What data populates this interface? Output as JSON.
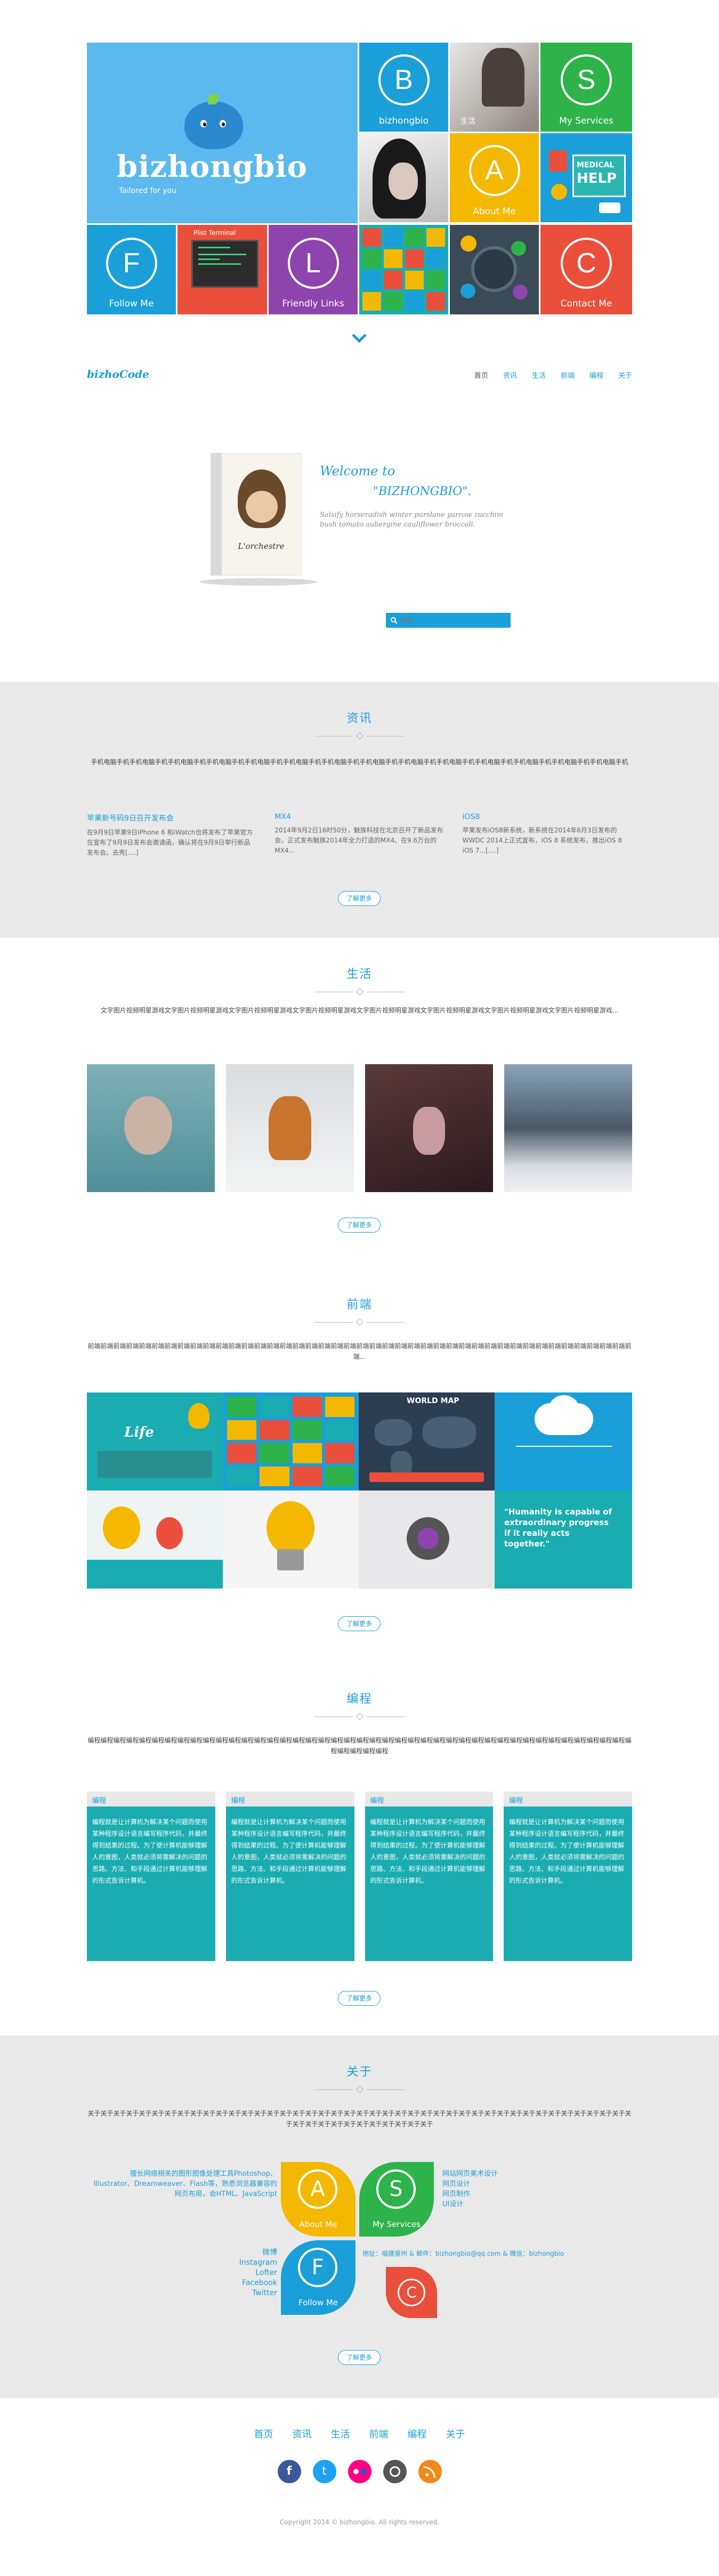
{
  "metro": {
    "brand": "bizhongbio",
    "tagline": "Tailored for you",
    "tiles": {
      "bizhongbio": {
        "letter": "B",
        "label": "bizhongbio"
      },
      "life": {
        "label": "生活"
      },
      "services": {
        "letter": "S",
        "label": "My Services"
      },
      "about": {
        "letter": "A",
        "label": "About Me"
      },
      "follow": {
        "letter": "F",
        "label": "Follow Me"
      },
      "terminal": {
        "title": "Plist Terminal"
      },
      "links": {
        "letter": "L",
        "label": "Friendly Links"
      },
      "contact": {
        "letter": "C",
        "label": "Contact Me"
      },
      "medical": {
        "line1": "MEDICAL",
        "line2": "HELP"
      }
    }
  },
  "nav": {
    "logo": "bizhoCode",
    "items": [
      "首页",
      "资讯",
      "生活",
      "前端",
      "编程",
      "关于"
    ]
  },
  "welcome": {
    "heading": "Welcome to",
    "name": "\"BIZHONGBIO\".",
    "body": "Salsify horseradish winter purslane yarrow zucchini bush tomato aubergine cauliflower broccoli.",
    "book_title": "L'orchestre"
  },
  "search": {
    "placeholder": "搜索"
  },
  "news": {
    "title": "资讯",
    "intro": "手机电脑手机手机电脑手机手机电脑手机手机电脑手机手机电脑手机手机电脑手机手机电脑手机手机电脑手机手机电脑手机手机电脑手机手机电脑手机手机电脑手机手机电脑手机手机电脑手机",
    "items": [
      {
        "title": "苹果新号码9日召开发布会",
        "body": "在9月9日苹果9日iPhone 6 和iWatch也将发布了苹果官方在宣布了9月9日发布会邀请函，确认将在9月9日举行新品发布会。去秀[....]"
      },
      {
        "title": "MX4",
        "body": "2014年9月2日16时50分，魅族科技在北京召开了新品发布会，正式发布魅族2014年全力打造的MX4。在9.6万台的MX4..."
      },
      {
        "title": "iOS8",
        "body": "苹果发布iOS8新系统，新系统在2014年6月3日发布的WWDC 2014上正式宣布，iOS 8 系统发布，推出iOS 8 iOS 7...[....]"
      }
    ],
    "more": "了解更多"
  },
  "life": {
    "title": "生活",
    "intro": "文字图片视频明星游戏文字图片视频明星游戏文字图片视频明星游戏文字图片视频明星游戏文字图片视频明星游戏文字图片视频明星游戏文字图片视频明星游戏文字图片视频明星游戏...",
    "more": "了解更多"
  },
  "frontend": {
    "title": "前端",
    "intro": "前端前端前端前端前端前端前端前端前端前端前端前端前端前端前端前端前端前端前端前端前端前端前端前端前端前端前端前端前端前端前端前端前端前端前端前端前端前端前端前端前端前端前端...",
    "life_label": "Life",
    "world_map": "WORLD MAP",
    "quote": "\"Humanity is capable of extraordinary progress if it really acts together.\"",
    "more": "了解更多"
  },
  "programming": {
    "title": "编程",
    "intro": "编程编程编程编程编程编程编程编程编程编程编程编程编程编程编程编程编程编程编程编程编程编程编程编程编程编程编程编程编程编程编程编程编程编程编程编程编程编程编程编程编程编程编程编程编程编程编程",
    "cards": [
      {
        "title": "编程",
        "body": "编程就是让计算机为解决某个问题而使用某种程序设计语言编写程序代码，并最终得到结果的过程。为了使计算机能够理解人的意图，人类就必须将需解决的问题的思路、方法、和手段通过计算机能够理解的形式告诉计算机。"
      },
      {
        "title": "编程",
        "body": "编程就是让计算机为解决某个问题而使用某种程序设计语言编写程序代码，并最终得到结果的过程。为了使计算机能够理解人的意图，人类就必须将需解决的问题的思路、方法、和手段通过计算机能够理解的形式告诉计算机。"
      },
      {
        "title": "编程",
        "body": "编程就是让计算机为解决某个问题而使用某种程序设计语言编写程序代码，并最终得到结果的过程。为了使计算机能够理解人的意图，人类就必须将需解决的问题的思路、方法、和手段通过计算机能够理解的形式告诉计算机。"
      },
      {
        "title": "编程",
        "body": "编程就是让计算机为解决某个问题而使用某种程序设计语言编写程序代码，并最终得到结果的过程。为了使计算机能够理解人的意图，人类就必须将需解决的问题的思路、方法、和手段通过计算机能够理解的形式告诉计算机。"
      }
    ],
    "more": "了解更多"
  },
  "about": {
    "title": "关于",
    "intro": "关于关于关于关于关于关于关于关于关于关于关于关于关于关于关于关于关于关于关于关于关于关于关于关于关于关于关于关于关于关于关于关于关于关于关于关于关于关于关于关于关于关于关于关于关于关于关于关于关于关于关于关于关于关于",
    "about_text": "擅长网络相关的图形图像处理工具Photoshop、Illustrator、Dreamweaver、Flash等，熟悉浏览器兼容的网页布局，会HTML、JavaScript",
    "services": [
      "网站网页美术设计",
      "网页设计",
      "网页制作",
      "UI设计"
    ],
    "follow": [
      "微博",
      "Instagram",
      "Lofter",
      "Facebook",
      "Twitter"
    ],
    "contact": "地址：福建泉州 & 邮件：bizhongbio@qq.com & 微信：bizhongbio",
    "petals": {
      "about": {
        "letter": "A",
        "label": "About Me"
      },
      "services": {
        "letter": "S",
        "label": "My Services"
      },
      "follow": {
        "letter": "F",
        "label": "Follow Me"
      },
      "contact": {
        "letter": "C"
      }
    },
    "more": "了解更多"
  },
  "footer": {
    "nav": [
      "首页",
      "资讯",
      "生活",
      "前端",
      "编程",
      "关于"
    ],
    "copyright": "Copyright 2014 © bizhongbio. All rights reserved."
  },
  "colors": {
    "accent": "#1a9fd8",
    "green": "#2db34a",
    "yellow": "#f4b800",
    "red": "#e94f3b",
    "purple": "#8e44ad",
    "teal": "#1aacb0"
  }
}
